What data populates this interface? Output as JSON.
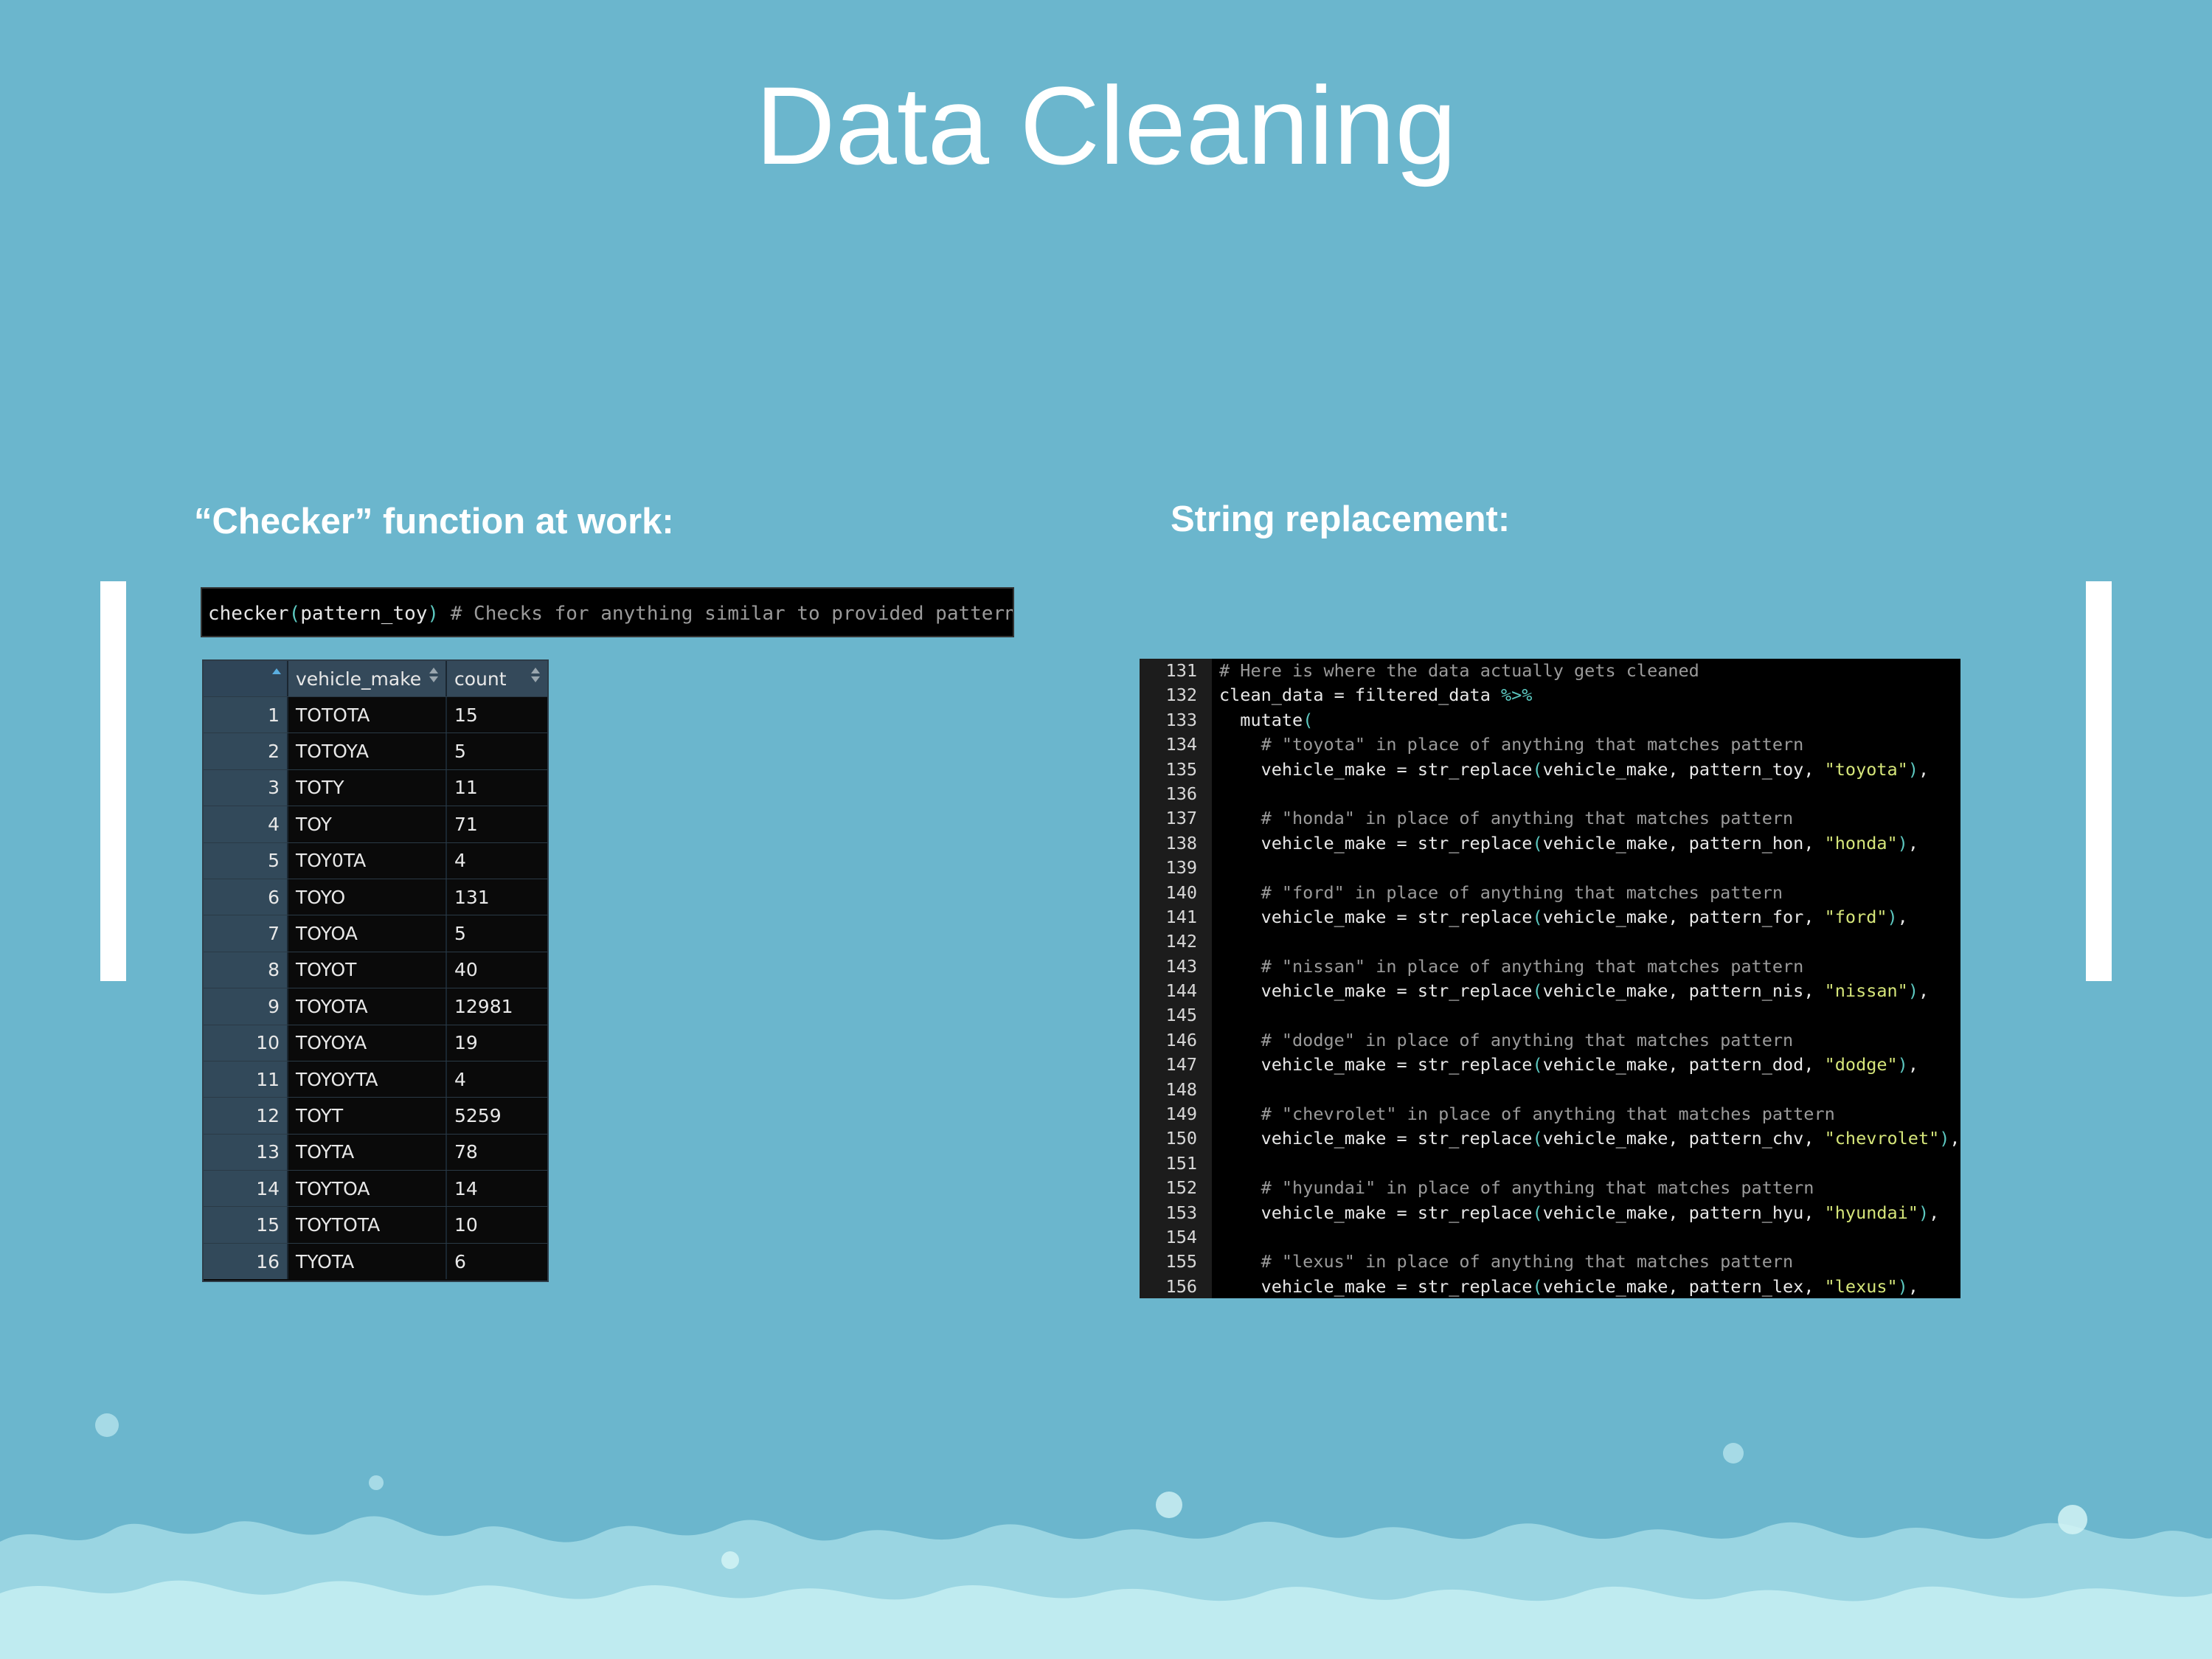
{
  "slide": {
    "title": "Data Cleaning",
    "left_heading": "“Checker” function at work:",
    "right_heading": "String replacement:"
  },
  "console": {
    "call": "checker",
    "open_paren": "(",
    "arg": "pattern_toy",
    "close_paren": ")",
    "comment": " # Checks for anything similar to provided pattern"
  },
  "table": {
    "columns": [
      "",
      "vehicle_make",
      "count"
    ],
    "rows": [
      {
        "idx": "1",
        "make": "TOTOTA",
        "count": "15"
      },
      {
        "idx": "2",
        "make": "TOTOYA",
        "count": "5"
      },
      {
        "idx": "3",
        "make": "TOTY",
        "count": "11"
      },
      {
        "idx": "4",
        "make": "TOY",
        "count": "71"
      },
      {
        "idx": "5",
        "make": "TOY0TA",
        "count": "4"
      },
      {
        "idx": "6",
        "make": "TOYO",
        "count": "131"
      },
      {
        "idx": "7",
        "make": "TOYOA",
        "count": "5"
      },
      {
        "idx": "8",
        "make": "TOYOT",
        "count": "40"
      },
      {
        "idx": "9",
        "make": "TOYOTA",
        "count": "12981"
      },
      {
        "idx": "10",
        "make": "TOYOYA",
        "count": "19"
      },
      {
        "idx": "11",
        "make": "TOYOYTA",
        "count": "4"
      },
      {
        "idx": "12",
        "make": "TOYT",
        "count": "5259"
      },
      {
        "idx": "13",
        "make": "TOYTA",
        "count": "78"
      },
      {
        "idx": "14",
        "make": "TOYTOA",
        "count": "14"
      },
      {
        "idx": "15",
        "make": "TOYTOTA",
        "count": "10"
      },
      {
        "idx": "16",
        "make": "TYOTA",
        "count": "6"
      }
    ]
  },
  "code": [
    {
      "n": "131",
      "t": [
        [
          "c",
          "# Here is where the data actually gets cleaned"
        ]
      ]
    },
    {
      "n": "132",
      "t": [
        [
          "x",
          "clean_data = filtered_data "
        ],
        [
          "p",
          "%>%"
        ]
      ]
    },
    {
      "n": "133",
      "t": [
        [
          "x",
          "  mutate"
        ],
        [
          "p",
          "("
        ]
      ]
    },
    {
      "n": "134",
      "t": [
        [
          "x",
          "    "
        ],
        [
          "c",
          "# \"toyota\" in place of anything that matches pattern"
        ]
      ]
    },
    {
      "n": "135",
      "t": [
        [
          "x",
          "    vehicle_make = str_replace"
        ],
        [
          "p",
          "("
        ],
        [
          "x",
          "vehicle_make, pattern_toy, "
        ],
        [
          "s",
          "\"toyota\""
        ],
        [
          "p",
          ")"
        ],
        [
          "x",
          ","
        ]
      ]
    },
    {
      "n": "136",
      "t": []
    },
    {
      "n": "137",
      "t": [
        [
          "x",
          "    "
        ],
        [
          "c",
          "# \"honda\" in place of anything that matches pattern"
        ]
      ]
    },
    {
      "n": "138",
      "t": [
        [
          "x",
          "    vehicle_make = str_replace"
        ],
        [
          "p",
          "("
        ],
        [
          "x",
          "vehicle_make, pattern_hon, "
        ],
        [
          "s",
          "\"honda\""
        ],
        [
          "p",
          ")"
        ],
        [
          "x",
          ","
        ]
      ]
    },
    {
      "n": "139",
      "t": []
    },
    {
      "n": "140",
      "t": [
        [
          "x",
          "    "
        ],
        [
          "c",
          "# \"ford\" in place of anything that matches pattern"
        ]
      ]
    },
    {
      "n": "141",
      "t": [
        [
          "x",
          "    vehicle_make = str_replace"
        ],
        [
          "p",
          "("
        ],
        [
          "x",
          "vehicle_make, pattern_for, "
        ],
        [
          "s",
          "\"ford\""
        ],
        [
          "p",
          ")"
        ],
        [
          "x",
          ","
        ]
      ]
    },
    {
      "n": "142",
      "t": []
    },
    {
      "n": "143",
      "t": [
        [
          "x",
          "    "
        ],
        [
          "c",
          "# \"nissan\" in place of anything that matches pattern"
        ]
      ]
    },
    {
      "n": "144",
      "t": [
        [
          "x",
          "    vehicle_make = str_replace"
        ],
        [
          "p",
          "("
        ],
        [
          "x",
          "vehicle_make, pattern_nis, "
        ],
        [
          "s",
          "\"nissan\""
        ],
        [
          "p",
          ")"
        ],
        [
          "x",
          ","
        ]
      ]
    },
    {
      "n": "145",
      "t": []
    },
    {
      "n": "146",
      "t": [
        [
          "x",
          "    "
        ],
        [
          "c",
          "# \"dodge\" in place of anything that matches pattern"
        ]
      ]
    },
    {
      "n": "147",
      "t": [
        [
          "x",
          "    vehicle_make = str_replace"
        ],
        [
          "p",
          "("
        ],
        [
          "x",
          "vehicle_make, pattern_dod, "
        ],
        [
          "s",
          "\"dodge\""
        ],
        [
          "p",
          ")"
        ],
        [
          "x",
          ","
        ]
      ]
    },
    {
      "n": "148",
      "t": []
    },
    {
      "n": "149",
      "t": [
        [
          "x",
          "    "
        ],
        [
          "c",
          "# \"chevrolet\" in place of anything that matches pattern"
        ]
      ]
    },
    {
      "n": "150",
      "t": [
        [
          "x",
          "    vehicle_make = str_replace"
        ],
        [
          "p",
          "("
        ],
        [
          "x",
          "vehicle_make, pattern_chv, "
        ],
        [
          "s",
          "\"chevrolet\""
        ],
        [
          "p",
          ")"
        ],
        [
          "x",
          ","
        ]
      ]
    },
    {
      "n": "151",
      "t": []
    },
    {
      "n": "152",
      "t": [
        [
          "x",
          "    "
        ],
        [
          "c",
          "# \"hyundai\" in place of anything that matches pattern"
        ]
      ]
    },
    {
      "n": "153",
      "t": [
        [
          "x",
          "    vehicle_make = str_replace"
        ],
        [
          "p",
          "("
        ],
        [
          "x",
          "vehicle_make, pattern_hyu, "
        ],
        [
          "s",
          "\"hyundai\""
        ],
        [
          "p",
          ")"
        ],
        [
          "x",
          ","
        ]
      ]
    },
    {
      "n": "154",
      "t": []
    },
    {
      "n": "155",
      "t": [
        [
          "x",
          "    "
        ],
        [
          "c",
          "# \"lexus\" in place of anything that matches pattern"
        ]
      ]
    },
    {
      "n": "156",
      "t": [
        [
          "x",
          "    vehicle_make = str_replace"
        ],
        [
          "p",
          "("
        ],
        [
          "x",
          "vehicle_make, pattern_lex, "
        ],
        [
          "s",
          "\"lexus\""
        ],
        [
          "p",
          ")"
        ],
        [
          "x",
          ","
        ]
      ]
    }
  ],
  "colors": {
    "background": "#6bb6cd",
    "string": "#d6e67a",
    "paren": "#5cc8c0",
    "comment": "#9a9a9a"
  }
}
